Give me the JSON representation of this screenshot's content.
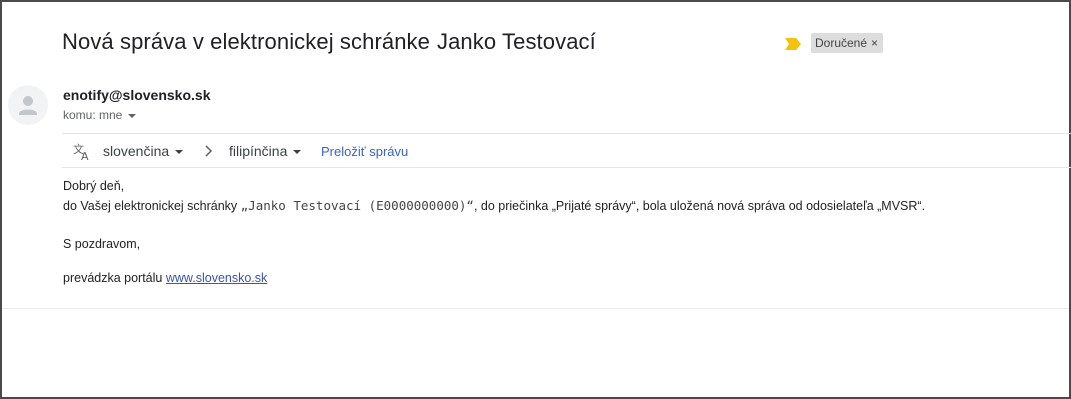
{
  "email": {
    "subject": "Nová správa v elektronickej schránke",
    "subject_name": "Janko Testovací",
    "label": "Doručené",
    "label_close": "×",
    "sender": "enotify@slovensko.sk",
    "recipient": "komu: mne"
  },
  "translate": {
    "source_lang": "slovenčina",
    "target_lang": "filipínčina",
    "action": "Preložiť správu"
  },
  "body": {
    "greeting": "Dobrý deň,",
    "line_prefix": "do Vašej elektronickej schránky",
    "line_mono": "„Janko Testovací (E0000000000)“",
    "line_suffix": ", do priečinka „Prijaté správy“, bola uložená nová správa od odosielateľa „MVSR“.",
    "regards": "S pozdravom,",
    "signature_prefix": "prevádzka portálu",
    "portal_link": "www.slovensko.sk"
  },
  "colors": {
    "importance_marker": "#f4c20d",
    "link": "#3a62c9",
    "label_bg": "#dddddd"
  },
  "icons": {
    "importance": "importance-marker-icon",
    "avatar": "person-icon",
    "translate": "translate-icon",
    "arrow": "chevron-right-icon"
  }
}
